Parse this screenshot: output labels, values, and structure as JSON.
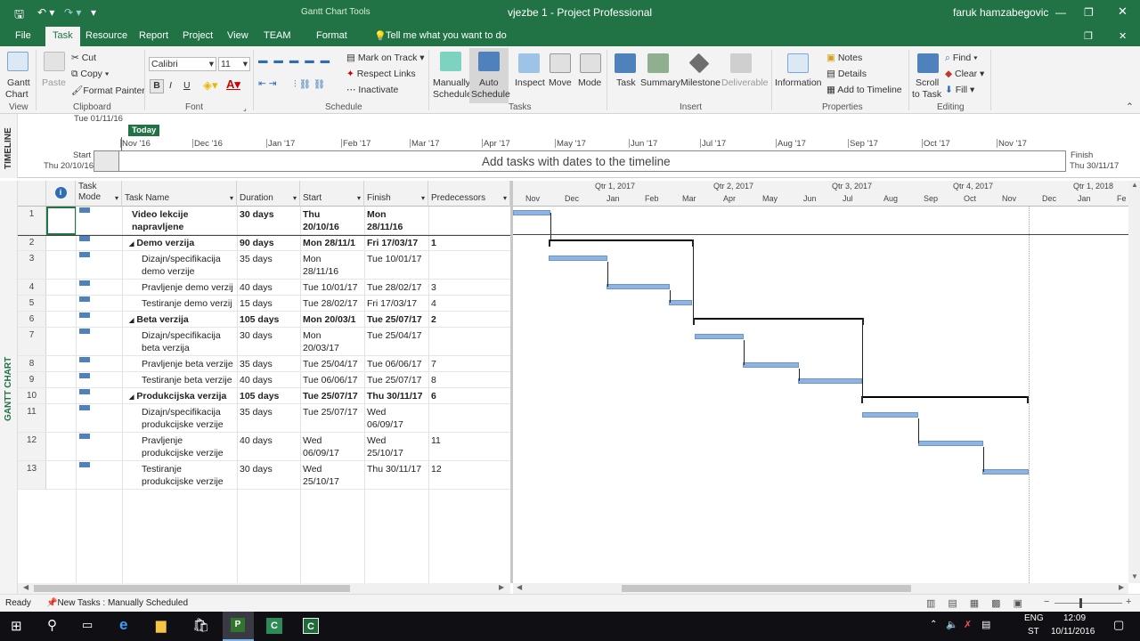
{
  "titlebar": {
    "app_title": "vjezbe 1 - Project Professional",
    "tools_label": "Gantt Chart Tools",
    "user": "faruk hamzabegovic",
    "help_text": "?"
  },
  "menu": {
    "tabs": [
      "File",
      "Task",
      "Resource",
      "Report",
      "Project",
      "View",
      "TEAM",
      "Format"
    ],
    "active": "Task",
    "tell_me": "Tell me what you want to do"
  },
  "ribbon": {
    "view": {
      "gantt": "Gantt",
      "chart": "Chart",
      "group": "View"
    },
    "clipboard": {
      "paste": "Paste",
      "cut": "Cut",
      "copy": "Copy",
      "format_painter": "Format Painter",
      "group": "Clipboard"
    },
    "font": {
      "name": "Calibri",
      "size": "11",
      "bold": "B",
      "italic": "I",
      "underline": "U",
      "group": "Font"
    },
    "schedule": {
      "mark_on_track": "Mark on Track",
      "respect_links": "Respect Links",
      "inactivate": "Inactivate",
      "group": "Schedule"
    },
    "tasks": {
      "manually": "Manually",
      "manually2": "Schedule",
      "auto": "Auto",
      "auto2": "Schedule",
      "inspect": "Inspect",
      "move": "Move",
      "mode": "Mode",
      "group": "Tasks"
    },
    "insert": {
      "task": "Task",
      "summary": "Summary",
      "milestone": "Milestone",
      "deliverable": "Deliverable",
      "group": "Insert"
    },
    "properties": {
      "information": "Information",
      "notes": "Notes",
      "details": "Details",
      "add_to_timeline": "Add to Timeline",
      "group": "Properties"
    },
    "editing": {
      "scroll": "Scroll",
      "scroll2": "to Task",
      "find": "Find",
      "clear": "Clear",
      "fill": "Fill",
      "group": "Editing"
    }
  },
  "timeline": {
    "side_label": "TIMELINE",
    "start_date_top": "Tue 01/11/16",
    "today": "Today",
    "months": [
      "Nov '16",
      "Dec '16",
      "Jan '17",
      "Feb '17",
      "Mar '17",
      "Apr '17",
      "May '17",
      "Jun '17",
      "Jul '17",
      "Aug '17",
      "Sep '17",
      "Oct '17",
      "Nov '17"
    ],
    "start_label": "Start",
    "start_date": "Thu 20/10/16",
    "finish_label": "Finish",
    "finish_date": "Thu 30/11/17",
    "placeholder": "Add tasks with dates to the timeline"
  },
  "grid": {
    "side_label": "GANTT CHART",
    "headers": {
      "info": "i",
      "mode": "Task Mode",
      "name": "Task Name",
      "duration": "Duration",
      "start": "Start",
      "finish": "Finish",
      "pred": "Predecessors"
    },
    "rows": [
      {
        "id": "1",
        "name": "Video lekcije",
        "name2": "napravljene",
        "duration": "30 days",
        "start": "Thu",
        "start2": "20/10/16",
        "finish": "Mon",
        "finish2": "28/11/16",
        "pred": "",
        "summary": true,
        "indent": false
      },
      {
        "id": "2",
        "name": "Demo verzija",
        "name2": "",
        "duration": "90 days",
        "start": "Mon 28/11/1",
        "start2": "",
        "finish": "Fri 17/03/17",
        "finish2": "",
        "pred": "1",
        "summary": true,
        "indent": false,
        "toggle": "◢"
      },
      {
        "id": "3",
        "name": "Dizajn/specifikacija",
        "name2": "demo verzije",
        "duration": "35 days",
        "start": "Mon",
        "start2": "28/11/16",
        "finish": "Tue 10/01/17",
        "finish2": "",
        "pred": "",
        "summary": false,
        "indent": true
      },
      {
        "id": "4",
        "name": "Pravljenje demo verzij",
        "name2": "",
        "duration": "40 days",
        "start": "Tue 10/01/17",
        "start2": "",
        "finish": "Tue 28/02/17",
        "finish2": "",
        "pred": "3",
        "summary": false,
        "indent": true
      },
      {
        "id": "5",
        "name": "Testiranje demo verzij",
        "name2": "",
        "duration": "15 days",
        "start": "Tue 28/02/17",
        "start2": "",
        "finish": "Fri 17/03/17",
        "finish2": "",
        "pred": "4",
        "summary": false,
        "indent": true
      },
      {
        "id": "6",
        "name": "Beta verzija",
        "name2": "",
        "duration": "105 days",
        "start": "Mon 20/03/1",
        "start2": "",
        "finish": "Tue 25/07/17",
        "finish2": "",
        "pred": "2",
        "summary": true,
        "indent": false,
        "toggle": "◢"
      },
      {
        "id": "7",
        "name": "Dizajn/specifikacija",
        "name2": "beta verzija",
        "duration": "30 days",
        "start": "Mon",
        "start2": "20/03/17",
        "finish": "Tue 25/04/17",
        "finish2": "",
        "pred": "",
        "summary": false,
        "indent": true
      },
      {
        "id": "8",
        "name": "Pravljenje beta verzije",
        "name2": "",
        "duration": "35 days",
        "start": "Tue 25/04/17",
        "start2": "",
        "finish": "Tue 06/06/17",
        "finish2": "",
        "pred": "7",
        "summary": false,
        "indent": true
      },
      {
        "id": "9",
        "name": "Testiranje beta verzije",
        "name2": "",
        "duration": "40 days",
        "start": "Tue 06/06/17",
        "start2": "",
        "finish": "Tue 25/07/17",
        "finish2": "",
        "pred": "8",
        "summary": false,
        "indent": true
      },
      {
        "id": "10",
        "name": "Produkcijska verzija",
        "name2": "",
        "duration": "105 days",
        "start": "Tue 25/07/17",
        "start2": "",
        "finish": "Thu 30/11/17",
        "finish2": "",
        "pred": "6",
        "summary": true,
        "indent": false,
        "toggle": "◢"
      },
      {
        "id": "11",
        "name": "Dizajn/specifikacija",
        "name2": "produkcijske verzije",
        "duration": "35 days",
        "start": "Tue 25/07/17",
        "start2": "",
        "finish": "Wed",
        "finish2": "06/09/17",
        "pred": "",
        "summary": false,
        "indent": true
      },
      {
        "id": "12",
        "name": "Pravljenje",
        "name2": "produkcijske verzije",
        "duration": "40 days",
        "start": "Wed",
        "start2": "06/09/17",
        "finish": "Wed",
        "finish2": "25/10/17",
        "pred": "11",
        "summary": false,
        "indent": true
      },
      {
        "id": "13",
        "name": "Testiranje",
        "name2": "produkcijske verzije",
        "duration": "30 days",
        "start": "Wed",
        "start2": "25/10/17",
        "finish": "Thu 30/11/17",
        "finish2": "",
        "pred": "12",
        "summary": false,
        "indent": true
      }
    ]
  },
  "chart": {
    "quarters": [
      "Qtr 1, 2017",
      "Qtr 2, 2017",
      "Qtr 3, 2017",
      "Qtr 4, 2017",
      "Qtr 1, 2018"
    ],
    "months": [
      "Nov",
      "Dec",
      "Jan",
      "Feb",
      "Mar",
      "Apr",
      "May",
      "Jun",
      "Jul",
      "Aug",
      "Sep",
      "Oct",
      "Nov",
      "Dec",
      "Jan",
      "Fe"
    ]
  },
  "status": {
    "ready": "Ready",
    "new_tasks": "New Tasks : Manually Scheduled"
  },
  "taskbar": {
    "lang": "ENG",
    "lang2": "ST",
    "time": "12:09",
    "date": "10/11/2016"
  }
}
